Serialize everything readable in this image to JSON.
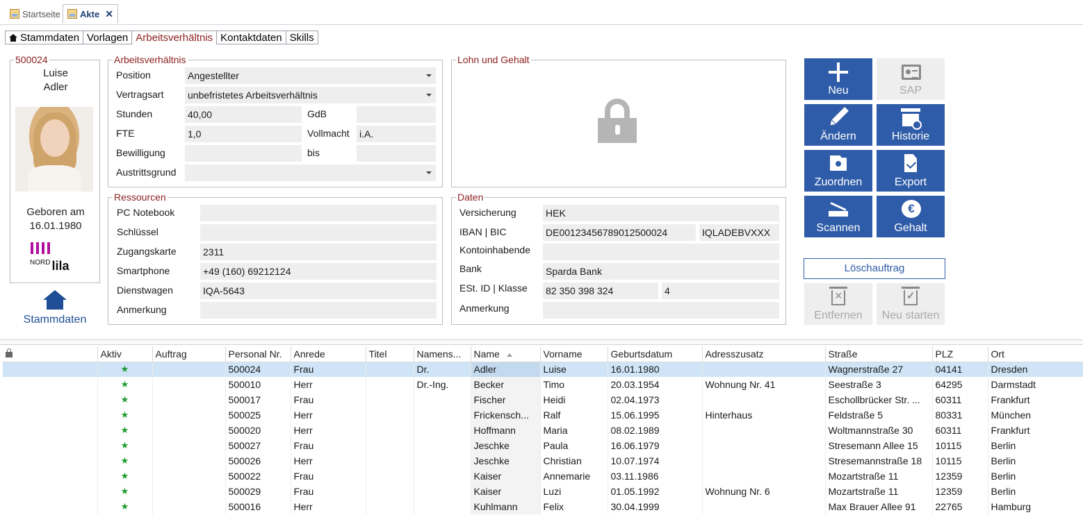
{
  "doc_tabs": [
    {
      "label": "Startseite",
      "active": false
    },
    {
      "label": "Akte",
      "active": true
    }
  ],
  "section_tabs": [
    "Stammdaten",
    "Vorlagen",
    "Arbeitsverhältnis",
    "Kontaktdaten",
    "Skills"
  ],
  "profile": {
    "id": "500024",
    "first_name": "Luise",
    "last_name": "Adler",
    "born_label": "Geboren am",
    "born_date": "16.01.1980",
    "logo_small": "NORD",
    "logo_big": "lila",
    "stammdaten_link": "Stammdaten"
  },
  "arbeitsverhaeltnis": {
    "title": "Arbeitsverhältnis",
    "position_label": "Position",
    "position_value": "Angestellter",
    "vertragsart_label": "Vertragsart",
    "vertragsart_value": "unbefristetes Arbeitsverhältnis",
    "stunden_label": "Stunden",
    "stunden_value": "40,00",
    "gdb_label": "GdB",
    "gdb_value": "",
    "fte_label": "FTE",
    "fte_value": "1,0",
    "vollmacht_label": "Vollmacht",
    "vollmacht_value": "i.A.",
    "bewilligung_label": "Bewilligung",
    "bewilligung_value": "",
    "bis_label": "bis",
    "bis_value": "",
    "austritt_label": "Austrittsgrund",
    "austritt_value": ""
  },
  "lohn": {
    "title": "Lohn und Gehalt"
  },
  "ressourcen": {
    "title": "Ressourcen",
    "rows": [
      {
        "label": "PC Notebook",
        "value": ""
      },
      {
        "label": "Schlüssel",
        "value": ""
      },
      {
        "label": "Zugangskarte",
        "value": "2311"
      },
      {
        "label": "Smartphone",
        "value": "+49 (160) 69212124"
      },
      {
        "label": "Dienstwagen",
        "value": "IQA-5643"
      },
      {
        "label": "Anmerkung",
        "value": ""
      }
    ]
  },
  "daten": {
    "title": "Daten",
    "versicherung_label": "Versicherung",
    "versicherung_value": "HEK",
    "iban_label": "IBAN | BIC",
    "iban_value": "DE00123456789012500024",
    "bic_value": "IQLADEBVXXX",
    "konto_label": "Kontoinhabende",
    "konto_value": "",
    "bank_label": "Bank",
    "bank_value": "Sparda Bank",
    "est_label": "ESt. ID | Klasse",
    "est_value": "82 350 398 324",
    "klasse_value": "4",
    "anm_label": "Anmerkung",
    "anm_value": ""
  },
  "actions": {
    "neu": "Neu",
    "sap": "SAP",
    "aendern": "Ändern",
    "historie": "Historie",
    "zuordnen": "Zuordnen",
    "export": "Export",
    "scannen": "Scannen",
    "gehalt": "Gehalt",
    "euro_symbol": "€",
    "loeschauftrag": "Löschauftrag",
    "entfernen": "Entfernen",
    "neu_starten": "Neu starten"
  },
  "grid": {
    "columns": [
      "",
      "Aktiv",
      "Auftrag",
      "Personal Nr.",
      "Anrede",
      "Titel",
      "Namens...",
      "Name",
      "Vorname",
      "Geburtsdatum",
      "Adresszusatz",
      "Straße",
      "PLZ",
      "Ort"
    ],
    "rows": [
      [
        "",
        "★",
        "",
        "500024",
        "Frau",
        "",
        "Dr.",
        "Adler",
        "Luise",
        "16.01.1980",
        "",
        "Wagnerstraße 27",
        "04141",
        "Dresden"
      ],
      [
        "",
        "★",
        "",
        "500010",
        "Herr",
        "",
        "Dr.-Ing.",
        "Becker",
        "Timo",
        "20.03.1954",
        "Wohnung Nr. 41",
        "Seestraße 3",
        "64295",
        "Darmstadt"
      ],
      [
        "",
        "★",
        "",
        "500017",
        "Frau",
        "",
        "",
        "Fischer",
        "Heidi",
        "02.04.1973",
        "",
        "Eschollbrücker Str. ...",
        "60311",
        "Frankfurt"
      ],
      [
        "",
        "★",
        "",
        "500025",
        "Herr",
        "",
        "",
        "Frickensch...",
        "Ralf",
        "15.06.1995",
        "Hinterhaus",
        "Feldstraße 5",
        "80331",
        "München"
      ],
      [
        "",
        "★",
        "",
        "500020",
        "Herr",
        "",
        "",
        "Hoffmann",
        "Maria",
        "08.02.1989",
        "",
        "Woltmannstraße 30",
        "60311",
        "Frankfurt"
      ],
      [
        "",
        "★",
        "",
        "500027",
        "Frau",
        "",
        "",
        "Jeschke",
        "Paula",
        "16.06.1979",
        "",
        "Stresemann Allee 15",
        "10115",
        "Berlin"
      ],
      [
        "",
        "★",
        "",
        "500026",
        "Herr",
        "",
        "",
        "Jeschke",
        "Christian",
        "10.07.1974",
        "",
        "Stresemannstraße 18",
        "10115",
        "Berlin"
      ],
      [
        "",
        "★",
        "",
        "500022",
        "Frau",
        "",
        "",
        "Kaiser",
        "Annemarie",
        "03.11.1986",
        "",
        "Mozartstraße 11",
        "12359",
        "Berlin"
      ],
      [
        "",
        "★",
        "",
        "500029",
        "Frau",
        "",
        "",
        "Kaiser",
        "Luzi",
        "01.05.1992",
        "Wohnung Nr. 6",
        "Mozartstraße 11",
        "12359",
        "Berlin"
      ],
      [
        "",
        "★",
        "",
        "500016",
        "Herr",
        "",
        "",
        "Kuhlmann",
        "Felix",
        "30.04.1999",
        "",
        "Max Brauer Allee 91",
        "22765",
        "Hamburg"
      ]
    ]
  }
}
